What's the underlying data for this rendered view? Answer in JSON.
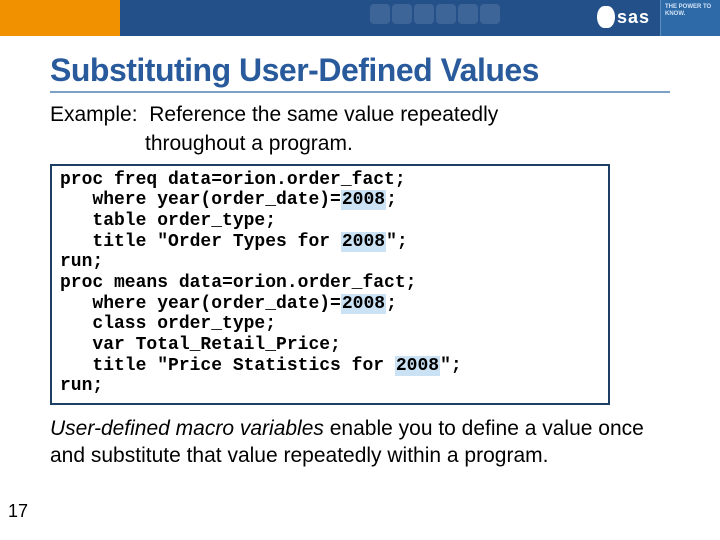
{
  "header": {
    "sas_text": "sas",
    "power_badge": "THE POWER TO KNOW."
  },
  "title": "Substituting User-Defined Values",
  "example_lead": "Example:",
  "example_rest": "Reference the same value repeatedly",
  "example_line2": "throughout a program.",
  "code": {
    "l1a": "proc freq data=orion.order_fact;",
    "l2a": "   where year(order_date)=",
    "l2b": "2008",
    "l2c": ";",
    "l3a": "   table order_type;",
    "l4a": "   title \"Order Types for ",
    "l4b": "2008",
    "l4c": "\";",
    "l5a": "run;",
    "l6a": "proc means data=orion.order_fact;",
    "l7a": "   where year(order_date)=",
    "l7b": "2008",
    "l7c": ";",
    "l8a": "   class order_type;",
    "l9a": "   var Total_Retail_Price;",
    "l10a": "   title \"Price Statistics for ",
    "l10b": "2008",
    "l10c": "\";",
    "l11a": "run;"
  },
  "bottom": {
    "em": "User-defined macro variables",
    "rest": " enable you to define a value once and substitute that value repeatedly within a program."
  },
  "page_number": "17"
}
